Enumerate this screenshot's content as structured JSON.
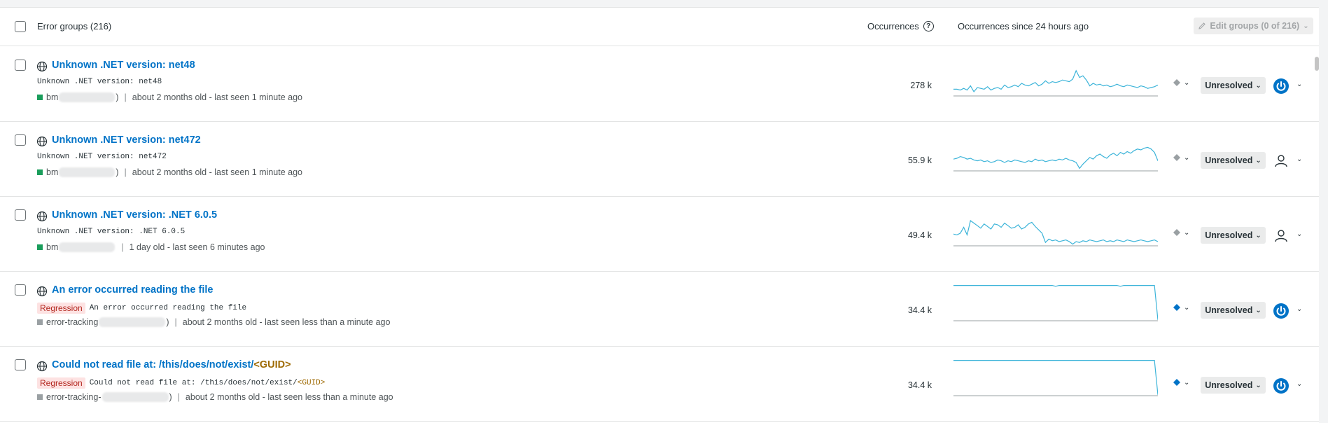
{
  "header": {
    "title": "Error groups (216)",
    "occurrences_label": "Occurrences",
    "occurrences_since_label": "Occurrences since 24 hours ago",
    "edit_groups_label": "Edit groups (0 of 216)",
    "help_glyph": "?"
  },
  "colors": {
    "link": "#0073c7",
    "sparkline": "#3cb4d9",
    "env_production": "#1a9d5b",
    "env_other": "#9aa0a3",
    "regression_bg": "#fde2e2",
    "guid": "#9e6a03"
  },
  "rows": [
    {
      "title": "Unknown .NET version: net48",
      "title_guid": "",
      "message": "Unknown .NET version: net48",
      "message_guid": "",
      "badge": "",
      "env_prefix": "bm",
      "env_suffix": ")",
      "env_color": "#1a9d5b",
      "age": "about 2 months old - last seen 1 minute ago",
      "count": "278 k",
      "status": "Unresolved",
      "assignee": "avatar",
      "priority": "none",
      "spark": [
        8,
        8,
        7,
        9,
        7,
        12,
        5,
        10,
        9,
        8,
        11,
        7,
        9,
        10,
        8,
        13,
        10,
        11,
        13,
        11,
        15,
        13,
        12,
        14,
        16,
        12,
        14,
        18,
        15,
        17,
        16,
        17,
        19,
        18,
        17,
        20,
        30,
        22,
        24,
        19,
        12,
        15,
        13,
        14,
        12,
        13,
        11,
        12,
        14,
        12,
        11,
        13,
        12,
        11,
        10,
        12,
        11,
        9,
        10,
        11,
        13
      ]
    },
    {
      "title": "Unknown .NET version: net472",
      "title_guid": "",
      "message": "Unknown .NET version: net472",
      "message_guid": "",
      "badge": "",
      "env_prefix": "bm",
      "env_suffix": ")",
      "env_color": "#1a9d5b",
      "age": "about 2 months old - last seen 1 minute ago",
      "count": "55.9 k",
      "status": "Unresolved",
      "assignee": "user",
      "priority": "none",
      "spark": [
        14,
        15,
        17,
        16,
        14,
        15,
        13,
        12,
        13,
        11,
        12,
        10,
        11,
        13,
        12,
        10,
        12,
        11,
        13,
        12,
        11,
        10,
        12,
        11,
        14,
        12,
        13,
        11,
        12,
        13,
        12,
        14,
        13,
        15,
        13,
        12,
        10,
        3,
        8,
        12,
        16,
        14,
        18,
        20,
        17,
        15,
        19,
        21,
        18,
        22,
        20,
        23,
        21,
        24,
        26,
        25,
        27,
        28,
        26,
        22,
        12
      ]
    },
    {
      "title": "Unknown .NET version: .NET 6.0.5",
      "title_guid": "",
      "message": "Unknown .NET version: .NET 6.0.5",
      "message_guid": "",
      "badge": "",
      "env_prefix": "bm",
      "env_suffix": "",
      "env_color": "#1a9d5b",
      "age": "1 day old - last seen 6 minutes ago",
      "count": "49.4 k",
      "status": "Unresolved",
      "assignee": "user",
      "priority": "none",
      "spark": [
        14,
        13,
        15,
        22,
        13,
        30,
        27,
        24,
        21,
        26,
        23,
        20,
        26,
        25,
        22,
        27,
        24,
        21,
        22,
        25,
        20,
        22,
        26,
        28,
        23,
        19,
        15,
        4,
        8,
        6,
        7,
        5,
        6,
        7,
        5,
        2,
        5,
        4,
        6,
        5,
        7,
        6,
        5,
        6,
        7,
        5,
        6,
        5,
        7,
        6,
        5,
        7,
        6,
        5,
        6,
        7,
        6,
        5,
        6,
        7,
        5
      ]
    },
    {
      "title": "An error occurred reading the file",
      "title_guid": "",
      "message": "An error occurred reading the file",
      "message_guid": "",
      "badge": "Regression",
      "env_prefix": "error-tracking",
      "env_suffix": ")",
      "env_color": "#9aa0a3",
      "age": "about 2 months old - last seen less than a minute ago",
      "count": "34.4 k",
      "status": "Unresolved",
      "assignee": "avatar",
      "priority": "medium",
      "spark": [
        42,
        42,
        42,
        42,
        42,
        42,
        42,
        42,
        42,
        42,
        42,
        42,
        42,
        42,
        42,
        42,
        42,
        42,
        42,
        42,
        42,
        42,
        42,
        42,
        42,
        42,
        42,
        42,
        42,
        42,
        41,
        42,
        42,
        42,
        42,
        42,
        42,
        42,
        42,
        42,
        42,
        42,
        42,
        42,
        42,
        42,
        42,
        42,
        42,
        41,
        42,
        42,
        42,
        42,
        42,
        42,
        42,
        42,
        42,
        42,
        1
      ]
    },
    {
      "title": "Could not read file at: /this/does/not/exist/",
      "title_guid": "<GUID>",
      "message": "Could not read file at: /this/does/not/exist/",
      "message_guid": "<GUID>",
      "badge": "Regression",
      "env_prefix": "error-tracking-",
      "env_suffix": ")",
      "env_color": "#9aa0a3",
      "age": "about 2 months old - last seen less than a minute ago",
      "count": "34.4 k",
      "status": "Unresolved",
      "assignee": "avatar",
      "priority": "medium",
      "spark": [
        42,
        42,
        42,
        42,
        42,
        42,
        42,
        42,
        42,
        42,
        42,
        42,
        42,
        42,
        42,
        42,
        42,
        42,
        42,
        42,
        42,
        42,
        42,
        42,
        42,
        42,
        42,
        42,
        42,
        42,
        42,
        42,
        42,
        42,
        42,
        42,
        42,
        42,
        42,
        42,
        42,
        42,
        42,
        42,
        42,
        42,
        42,
        42,
        42,
        42,
        42,
        42,
        42,
        42,
        42,
        42,
        42,
        42,
        42,
        42,
        1
      ]
    }
  ]
}
